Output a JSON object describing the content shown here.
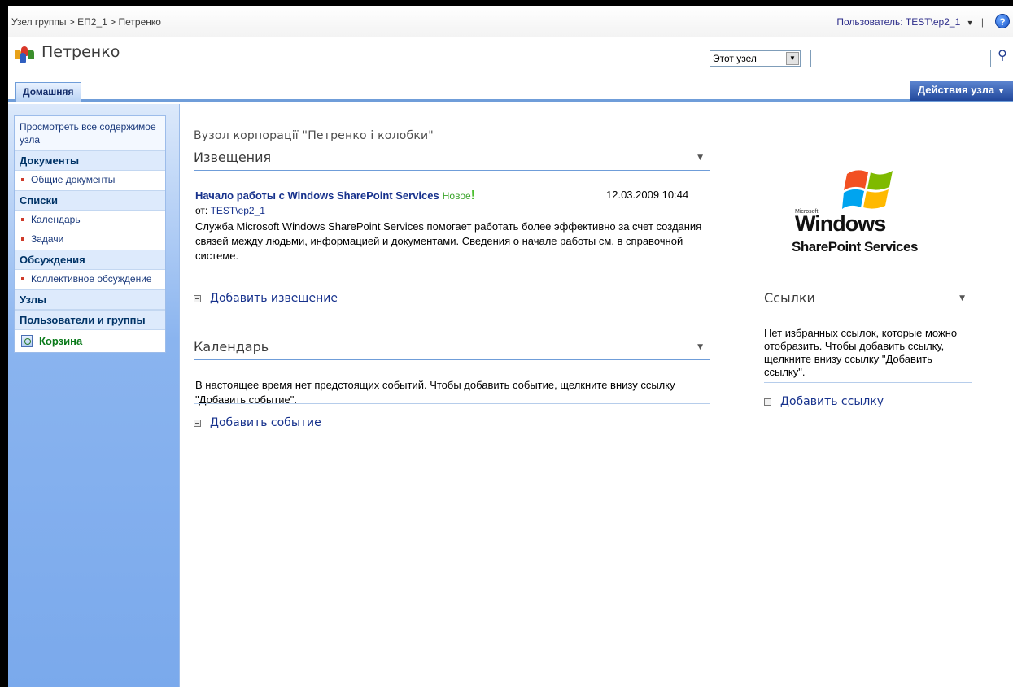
{
  "breadcrumb": {
    "part1": "Узел группы",
    "sep1": " > ",
    "part2": "ЕП2_1",
    "sep2": " > ",
    "part3": "Петренко"
  },
  "user": {
    "label": "Пользователь: TEST\\ep2_1",
    "caret": "▼",
    "sep": "|"
  },
  "help": {
    "glyph": "?"
  },
  "site": {
    "title": "Петренко"
  },
  "search": {
    "scope": "Этот узел",
    "scope_caret": "▼",
    "query": "",
    "button_glyph": "⚲"
  },
  "tabs": {
    "home": "Домашняя"
  },
  "site_actions": {
    "label": "Действия узла",
    "caret": "▼"
  },
  "quicklaunch": {
    "view_all": "Просмотреть все содержимое узла",
    "documents_header": "Документы",
    "documents_items": [
      "Общие документы"
    ],
    "lists_header": "Списки",
    "lists_items": [
      "Календарь",
      "Задачи"
    ],
    "discussions_header": "Обсуждения",
    "discussions_items": [
      "Коллективное обсуждение"
    ],
    "sites_header": "Узлы",
    "people_header": "Пользователи и группы",
    "recycle_bin": "Корзина"
  },
  "main": {
    "site_description": "Вузол корпорації \"Петренко і колобки\"",
    "announcements": {
      "title": "Извещения",
      "menu_caret": "▼",
      "item_title": "Начало работы с Windows SharePoint Services",
      "item_new": "Новое",
      "item_new_mark": "!",
      "item_date": "12.03.2009 10:44",
      "item_from_label": "от: ",
      "item_from_user": "TEST\\ep2_1",
      "item_body": "Служба Microsoft Windows SharePoint Services помогает работать более эффективно за счет создания связей между людьми, информацией и документами. Сведения о начале работы см. в справочной системе.",
      "add_link": "Добавить извещение"
    },
    "calendar": {
      "title": "Календарь",
      "menu_caret": "▼",
      "body": "В настоящее время нет предстоящих событий. Чтобы добавить событие, щелкните внизу ссылку \"Добавить событие\".",
      "add_link": "Добавить событие"
    },
    "logo": {
      "microsoft": "Microsoft",
      "windows": "Windows",
      "sharepoint": "SharePoint Services"
    },
    "links": {
      "title": "Ссылки",
      "menu_caret": "▼",
      "body": "Нет избранных ссылок, которые можно отобразить. Чтобы добавить ссылку, щелкните внизу ссылку \"Добавить ссылку\".",
      "add_link": "Добавить ссылку"
    }
  },
  "colors": {
    "accent": "#6f9dd9",
    "link": "#16318c",
    "new_badge": "#3aa32a",
    "recycle": "#0a7a1a",
    "site_actions_bg": "#21479b"
  }
}
